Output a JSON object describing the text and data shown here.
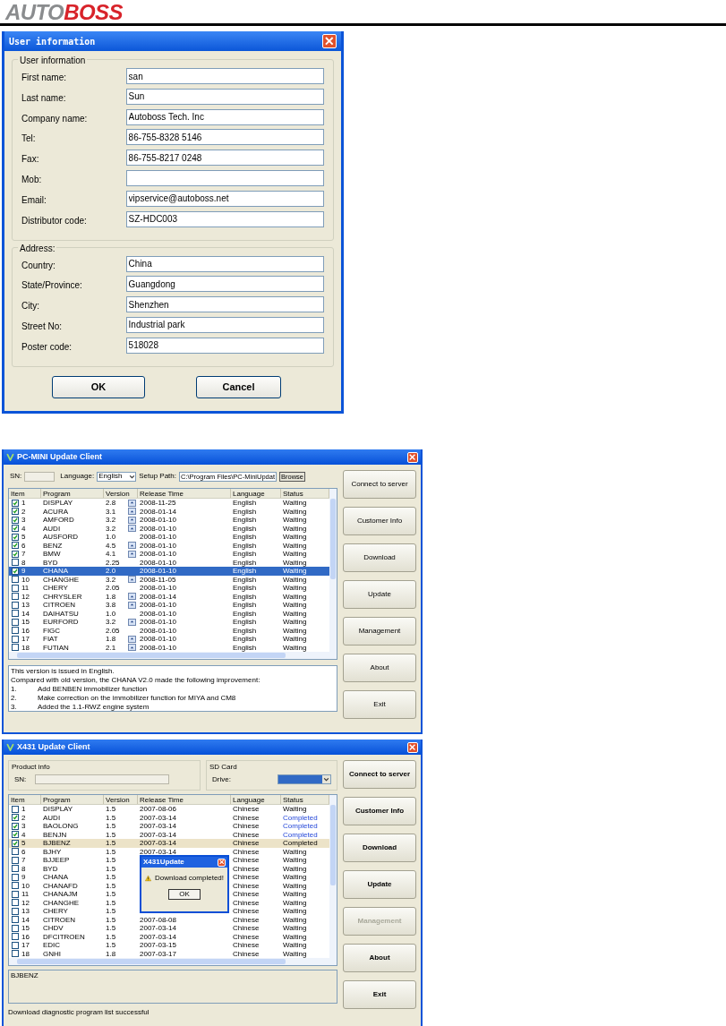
{
  "logo": {
    "left": "AUTO",
    "right": "BOSS"
  },
  "user_dialog": {
    "title": "User information",
    "groups": [
      {
        "legend": "User information",
        "fields": [
          {
            "label": "First name:",
            "value": "san"
          },
          {
            "label": "Last name:",
            "value": "Sun"
          },
          {
            "label": "Company name:",
            "value": "Autoboss Tech. Inc"
          },
          {
            "label": "Tel:",
            "value": "86-755-8328 5146"
          },
          {
            "label": "Fax:",
            "value": "86-755-8217 0248"
          },
          {
            "label": "Mob:"
          },
          {
            "label": "Email:",
            "value": "vipservice@autoboss.net"
          },
          {
            "label": "Distributor code:",
            "value": "SZ-HDC003"
          }
        ]
      },
      {
        "legend": "Address:",
        "fields": [
          {
            "label": "Country:",
            "value": "China"
          },
          {
            "label": "State/Province:",
            "value": "Guangdong"
          },
          {
            "label": "City:",
            "value": "Shenzhen"
          },
          {
            "label": "Street No:",
            "value": "Industrial park"
          },
          {
            "label": "Poster code:",
            "value": "518028"
          }
        ]
      }
    ],
    "buttons": [
      "OK",
      "Cancel"
    ]
  },
  "client_en": {
    "title": "PC-MINI Update Client",
    "sn_label": "SN:",
    "language_label": "Language:",
    "language": "English",
    "path_label": "Setup Path:",
    "path": "C:\\Program Files\\PC-MiniUpdat",
    "browse": "Browse",
    "columns": [
      "Item",
      "Program",
      "Version",
      "Release Time",
      "Language",
      "Status"
    ],
    "rows": [
      {
        "item": "1",
        "program": "DISPLAY",
        "version": "2.8",
        "note_button": true,
        "release": "2008-11-25",
        "language": "English",
        "status": "Waiting",
        "checked": true,
        "selected": false
      },
      {
        "item": "2",
        "program": "ACURA",
        "version": "3.1",
        "note_button": true,
        "release": "2008-01-14",
        "language": "English",
        "status": "Waiting",
        "checked": true,
        "selected": false
      },
      {
        "item": "3",
        "program": "AMFORD",
        "version": "3.2",
        "note_button": true,
        "release": "2008-01-10",
        "language": "English",
        "status": "Waiting",
        "checked": true,
        "selected": false
      },
      {
        "item": "4",
        "program": "AUDI",
        "version": "3.2",
        "note_button": true,
        "release": "2008-01-10",
        "language": "English",
        "status": "Waiting",
        "checked": true,
        "selected": false
      },
      {
        "item": "5",
        "program": "AUSFORD",
        "version": "1.0",
        "note_button": false,
        "release": "2008-01-10",
        "language": "English",
        "status": "Waiting",
        "checked": true,
        "selected": false
      },
      {
        "item": "6",
        "program": "BENZ",
        "version": "4.5",
        "note_button": true,
        "release": "2008-01-10",
        "language": "English",
        "status": "Waiting",
        "checked": true,
        "selected": false
      },
      {
        "item": "7",
        "program": "BMW",
        "version": "4.1",
        "note_button": true,
        "release": "2008-01-10",
        "language": "English",
        "status": "Waiting",
        "checked": true,
        "selected": false
      },
      {
        "item": "8",
        "program": "BYD",
        "version": "2.25",
        "note_button": false,
        "release": "2008-01-10",
        "language": "English",
        "status": "Waiting",
        "checked": false,
        "selected": false
      },
      {
        "item": "9",
        "program": "CHANA",
        "version": "2.0",
        "note_button": false,
        "release": "2008-01-10",
        "language": "English",
        "status": "Waiting",
        "checked": true,
        "selected": true
      },
      {
        "item": "10",
        "program": "CHANGHE",
        "version": "3.2",
        "note_button": true,
        "release": "2008-11-05",
        "language": "English",
        "status": "Waiting",
        "checked": false,
        "selected": false
      },
      {
        "item": "11",
        "program": "CHERY",
        "version": "2.05",
        "note_button": false,
        "release": "2008-01-10",
        "language": "English",
        "status": "Waiting",
        "checked": false,
        "selected": false
      },
      {
        "item": "12",
        "program": "CHRYSLER",
        "version": "1.8",
        "note_button": true,
        "release": "2008-01-14",
        "language": "English",
        "status": "Waiting",
        "checked": false,
        "selected": false
      },
      {
        "item": "13",
        "program": "CITROEN",
        "version": "3.8",
        "note_button": true,
        "release": "2008-01-10",
        "language": "English",
        "status": "Waiting",
        "checked": false,
        "selected": false
      },
      {
        "item": "14",
        "program": "DAIHATSU",
        "version": "1.0",
        "note_button": false,
        "release": "2008-01-10",
        "language": "English",
        "status": "Waiting",
        "checked": false,
        "selected": false
      },
      {
        "item": "15",
        "program": "EURFORD",
        "version": "3.2",
        "note_button": true,
        "release": "2008-01-10",
        "language": "English",
        "status": "Waiting",
        "checked": false,
        "selected": false
      },
      {
        "item": "16",
        "program": "FIGC",
        "version": "2.05",
        "note_button": false,
        "release": "2008-01-10",
        "language": "English",
        "status": "Waiting",
        "checked": false,
        "selected": false
      },
      {
        "item": "17",
        "program": "FIAT",
        "version": "1.8",
        "note_button": true,
        "release": "2008-01-10",
        "language": "English",
        "status": "Waiting",
        "checked": false,
        "selected": false
      },
      {
        "item": "18",
        "program": "FUTIAN",
        "version": "2.1",
        "note_button": true,
        "release": "2008-01-10",
        "language": "English",
        "status": "Waiting",
        "checked": false,
        "selected": false
      }
    ],
    "description": [
      {
        "text": "This version is issued in English."
      },
      {
        "text": "Compared with old version, the CHANA V2.0 made the following improvement:"
      },
      {
        "num": "1.",
        "text": "Add BENBEN immobilizer function"
      },
      {
        "num": "2.",
        "text": "Make correction on the immobilizer function for MIYA and CM8"
      },
      {
        "num": "3.",
        "text": "Added the 1.1-RWZ engine system"
      }
    ],
    "buttons": [
      {
        "label": "Connect to server",
        "disabled": false
      },
      {
        "label": "Customer Info",
        "disabled": false
      },
      {
        "label": "Download",
        "disabled": false
      },
      {
        "label": "Update",
        "disabled": false
      },
      {
        "label": "Management",
        "disabled": false
      },
      {
        "label": "About",
        "disabled": false
      },
      {
        "label": "Exit",
        "disabled": false
      }
    ]
  },
  "client_cn": {
    "title": "X431 Update Client",
    "product_legend": "Product info",
    "sn_label": "SN:",
    "sd_legend": "SD Card",
    "drive_label": "Drive:",
    "columns": [
      "Item",
      "Program",
      "Version",
      "Release Time",
      "Language",
      "Status"
    ],
    "rows": [
      {
        "item": "1",
        "program": "DISPLAY",
        "version": "1.5",
        "release": "2007-08-06",
        "language": "Chinese",
        "status": "Waiting",
        "done": false,
        "checked": false,
        "selected": false
      },
      {
        "item": "2",
        "program": "AUDI",
        "version": "1.5",
        "release": "2007-03-14",
        "language": "Chinese",
        "status": "Completed",
        "done": true,
        "checked": true,
        "selected": false
      },
      {
        "item": "3",
        "program": "BAOLONG",
        "version": "1.5",
        "release": "2007-03-14",
        "language": "Chinese",
        "status": "Completed",
        "done": true,
        "checked": true,
        "selected": false
      },
      {
        "item": "4",
        "program": "BENJN",
        "version": "1.5",
        "release": "2007-03-14",
        "language": "Chinese",
        "status": "Completed",
        "done": true,
        "checked": true,
        "selected": false
      },
      {
        "item": "5",
        "program": "BJBENZ",
        "version": "1.5",
        "release": "2007-03-14",
        "language": "Chinese",
        "status": "Completed",
        "done": true,
        "checked": true,
        "selected": true
      },
      {
        "item": "6",
        "program": "BJHY",
        "version": "1.5",
        "release": "2007-03-14",
        "language": "Chinese",
        "status": "Waiting",
        "done": false,
        "checked": false,
        "selected": false
      },
      {
        "item": "7",
        "program": "BJJEEP",
        "version": "1.5",
        "language": "Chinese",
        "status": "Waiting",
        "done": false,
        "checked": false,
        "selected": false
      },
      {
        "item": "8",
        "program": "BYD",
        "version": "1.5",
        "language": "Chinese",
        "status": "Waiting",
        "done": false,
        "checked": false,
        "selected": false
      },
      {
        "item": "9",
        "program": "CHANA",
        "version": "1.5",
        "language": "Chinese",
        "status": "Waiting",
        "done": false,
        "checked": false,
        "selected": false
      },
      {
        "item": "10",
        "program": "CHANAFD",
        "version": "1.5",
        "language": "Chinese",
        "status": "Waiting",
        "done": false,
        "checked": false,
        "selected": false
      },
      {
        "item": "11",
        "program": "CHANAJM",
        "version": "1.5",
        "language": "Chinese",
        "status": "Waiting",
        "done": false,
        "checked": false,
        "selected": false
      },
      {
        "item": "12",
        "program": "CHANGHE",
        "version": "1.5",
        "language": "Chinese",
        "status": "Waiting",
        "done": false,
        "checked": false,
        "selected": false
      },
      {
        "item": "13",
        "program": "CHERY",
        "version": "1.5",
        "language": "Chinese",
        "status": "Waiting",
        "done": false,
        "checked": false,
        "selected": false
      },
      {
        "item": "14",
        "program": "CITROEN",
        "version": "1.5",
        "release": "2007-08-08",
        "language": "Chinese",
        "status": "Waiting",
        "done": false,
        "checked": false,
        "selected": false
      },
      {
        "item": "15",
        "program": "CHDV",
        "version": "1.5",
        "release": "2007-03-14",
        "language": "Chinese",
        "status": "Waiting",
        "done": false,
        "checked": false,
        "selected": false
      },
      {
        "item": "16",
        "program": "DFCITROEN",
        "version": "1.5",
        "release": "2007-03-14",
        "language": "Chinese",
        "status": "Waiting",
        "done": false,
        "checked": false,
        "selected": false
      },
      {
        "item": "17",
        "program": "EDIC",
        "version": "1.5",
        "release": "2007-03-15",
        "language": "Chinese",
        "status": "Waiting",
        "done": false,
        "checked": false,
        "selected": false
      },
      {
        "item": "18",
        "program": "GNHI",
        "version": "1.8",
        "release": "2007-03-17",
        "language": "Chinese",
        "status": "Waiting",
        "done": false,
        "checked": false,
        "selected": false
      }
    ],
    "dialog": {
      "title": "X431Update",
      "message": "Download completed!",
      "button": "OK"
    },
    "log": "BJBENZ",
    "status_bar": "Download diagnostic program list successful",
    "buttons": [
      {
        "label": "Connect to server",
        "disabled": false
      },
      {
        "label": "Customer Info",
        "disabled": false
      },
      {
        "label": "Download",
        "disabled": false
      },
      {
        "label": "Update",
        "disabled": false
      },
      {
        "label": "Management",
        "disabled": true
      },
      {
        "label": "About",
        "disabled": false
      },
      {
        "label": "Exit",
        "disabled": false
      }
    ]
  }
}
